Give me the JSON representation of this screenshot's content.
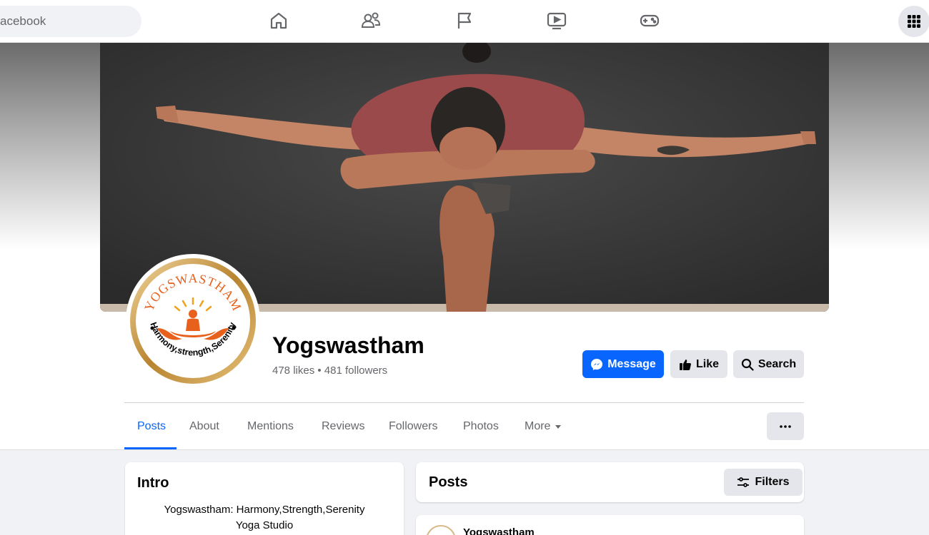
{
  "nav": {
    "search_text": "acebook",
    "icons": [
      "home-icon",
      "friends-icon",
      "pages-flag-icon",
      "watch-video-icon",
      "gaming-icon",
      "menu-grid-icon"
    ]
  },
  "page": {
    "name": "Yogswastham",
    "stats": "478 likes • 481 followers",
    "logo_text": {
      "top": "YOGSWASTHAM",
      "bottom": "Harmony,strength,Serenity"
    }
  },
  "actions": {
    "message": "Message",
    "like": "Like",
    "search": "Search"
  },
  "tabs": [
    {
      "label": "Posts",
      "active": true
    },
    {
      "label": "About",
      "active": false
    },
    {
      "label": "Mentions",
      "active": false
    },
    {
      "label": "Reviews",
      "active": false
    },
    {
      "label": "Followers",
      "active": false
    },
    {
      "label": "Photos",
      "active": false
    },
    {
      "label": "More",
      "active": false
    }
  ],
  "intro": {
    "title": "Intro",
    "line1": "Yogswastham: Harmony,Strength,Serenity",
    "line2": "Yoga Studio"
  },
  "posts": {
    "title": "Posts",
    "filters": "Filters",
    "first_author": "Yogswastham"
  },
  "colors": {
    "accent": "#0866ff",
    "logo_orange": "#e8611c",
    "logo_gold": "#c9963c"
  }
}
